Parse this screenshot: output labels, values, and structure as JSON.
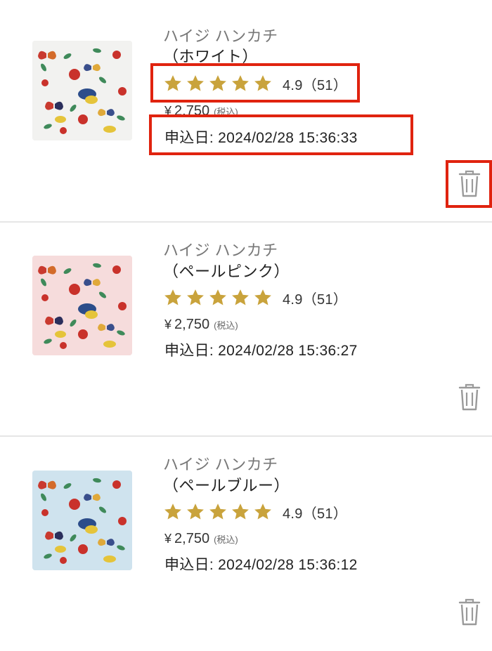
{
  "items": [
    {
      "name_line1": "ハイジ ハンカチ",
      "name_line2": "（ホワイト）",
      "rating_text": "4.9（51）",
      "price_value": "2,750",
      "price_yen": "¥",
      "price_tax": "(税込)",
      "date_text": "申込日: 2024/02/28 15:36:33",
      "thumb_bg": "#f2f2f0"
    },
    {
      "name_line1": "ハイジ ハンカチ",
      "name_line2": "（ペールピンク）",
      "rating_text": "4.9（51）",
      "price_value": "2,750",
      "price_yen": "¥",
      "price_tax": "(税込)",
      "date_text": "申込日: 2024/02/28 15:36:27",
      "thumb_bg": "#f6dcdc"
    },
    {
      "name_line1": "ハイジ ハンカチ",
      "name_line2": "（ペールブルー）",
      "rating_text": "4.9（51）",
      "price_value": "2,750",
      "price_yen": "¥",
      "price_tax": "(税込)",
      "date_text": "申込日: 2024/02/28 15:36:12",
      "thumb_bg": "#cfe3ee"
    }
  ],
  "rating_stars": 5,
  "colors": {
    "star": "#c9a33c",
    "highlight": "#e0230f",
    "trash": "#9a9a9a"
  },
  "icons": [
    "star-icon",
    "trash-icon"
  ]
}
